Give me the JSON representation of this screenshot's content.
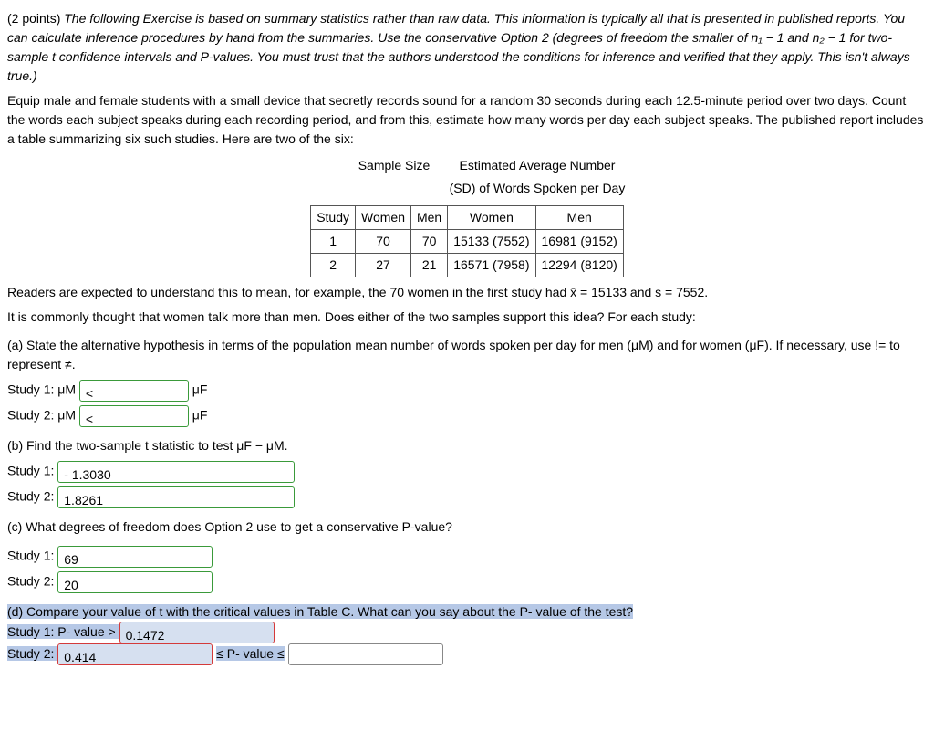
{
  "intro": {
    "points": "(2 points)",
    "line1": "The following Exercise is based on summary statistics rather than raw data. This information is typically all that is presented in published reports. You can calculate inference procedures by hand from the summaries. Use the conservative Option 2 (degrees of freedom the smaller of n₁ − 1 and n₂ − 1 for two-sample t confidence intervals and P-values. You must trust that the authors understood the conditions for inference and verified that they apply. This isn't always true.)"
  },
  "setup": "Equip male and female students with a small device that secretly records sound for a random 30 seconds during each 12.5-minute period over two days. Count the words each subject speaks during each recording period, and from this, estimate how many words per day each subject speaks. The published report includes a table summarizing six such studies. Here are two of the six:",
  "table": {
    "head1": "Sample Size",
    "head2": "Estimated Average Number",
    "head2b": "(SD) of Words Spoken per Day",
    "cols": [
      "Study",
      "Women",
      "Men",
      "Women",
      "Men"
    ],
    "rows": [
      [
        "1",
        "70",
        "70",
        "15133 (7552)",
        "16981 (9152)"
      ],
      [
        "2",
        "27",
        "21",
        "16571 (7958)",
        "12294 (8120)"
      ]
    ]
  },
  "readers": "Readers are expected to understand this to mean, for example, the 70 women in the first study had x̄ = 15133 and s = 7552.",
  "commonly": "It is commonly thought that women talk more than men. Does either of the two samples support this idea? For each study:",
  "partA": {
    "prompt": "(a) State the alternative hypothesis in terms of the population mean number of words spoken per day for men (μM) and for women (μF). If necessary, use != to represent ≠.",
    "study1_prefix": "Study 1: μM",
    "study1_val": "<",
    "study1_suffix": "μF",
    "study2_prefix": "Study 2: μM",
    "study2_val": "<",
    "study2_suffix": "μF"
  },
  "partB": {
    "prompt": "(b) Find the two-sample t statistic to test μF − μM.",
    "study1_label": "Study 1:",
    "study1_val": "- 1.3030",
    "study2_label": "Study 2:",
    "study2_val": "1.8261"
  },
  "partC": {
    "prompt": "(c) What degrees of freedom does Option 2 use to get a conservative P-value?",
    "study1_label": "Study 1:",
    "study1_val": "69",
    "study2_label": "Study 2:",
    "study2_val": "20"
  },
  "partD": {
    "prompt": "(d) Compare your value of t with the critical values in Table C. What can you say about the P- value of the test?",
    "study1_prefix": "Study 1: P- value >",
    "study1_val": "0.1472",
    "study2_prefix": "Study 2:",
    "study2_val": "0.414",
    "study2_mid": "≤ P- value ≤",
    "study2_val2": ""
  }
}
